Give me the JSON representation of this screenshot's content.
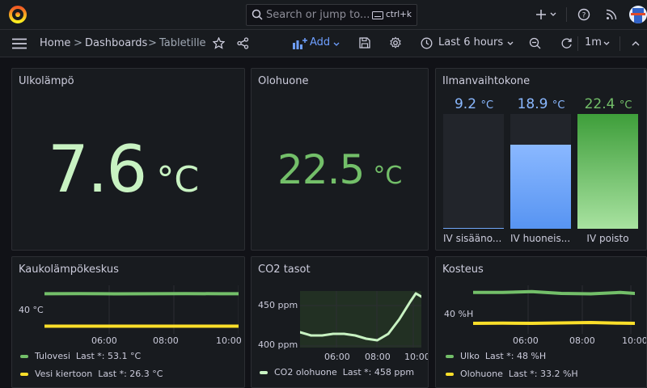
{
  "topbar": {
    "search_placeholder": "Search or jump to...",
    "shortcut": "ctrl+k"
  },
  "nav": {
    "crumb_home": "Home",
    "crumb_dashboards": "Dashboards",
    "crumb_current": "Tabletille",
    "separator": ">",
    "add_label": "Add",
    "time_range": "Last 6 hours",
    "refresh_interval": "1m"
  },
  "colors": {
    "accent_blue": "#6e9fff",
    "green": "#73bf69",
    "light_green": "#c8f2c2",
    "yellow": "#fade2a",
    "light_blue": "#8ab8ff"
  },
  "panels": {
    "ulko": {
      "title": "Ulkolämpö",
      "value": "7.6",
      "unit": "°C"
    },
    "olohuone": {
      "title": "Olohuone",
      "value": "22.5",
      "unit": "°C"
    },
    "iv": {
      "title": "Ilmanvaihtokone",
      "gauges": [
        {
          "value": "9.2",
          "unit": "°C",
          "label": "IV sisäänotto",
          "label_shown": "IV sisääno...",
          "fill": 0.01
        },
        {
          "value": "18.9",
          "unit": "°C",
          "label": "IV huoneisto",
          "label_shown": "IV huoneis...",
          "fill": 0.73
        },
        {
          "value": "22.4",
          "unit": "°C",
          "label": "IV poisto",
          "label_shown": "IV poisto",
          "fill": 1.0
        }
      ]
    },
    "kauko": {
      "title": "Kaukolämpökeskus",
      "y_tick": "40 °C",
      "x_ticks": [
        "06:00",
        "08:00",
        "10:00"
      ],
      "legend": [
        {
          "name": "Tulovesi",
          "last": "Last *: 53.1 °C"
        },
        {
          "name": "Vesi kiertoon",
          "last": "Last *: 26.3 °C"
        }
      ]
    },
    "co2": {
      "title": "CO2 tasot",
      "y_ticks": [
        "450 ppm",
        "400 ppm"
      ],
      "x_ticks": [
        "06:00",
        "08:00",
        "10:00"
      ],
      "legend": [
        {
          "name": "CO2 olohuone",
          "last": "Last *: 458 ppm"
        }
      ]
    },
    "kosteus": {
      "title": "Kosteus",
      "y_tick": "40 %H",
      "x_ticks": [
        "06:00",
        "08:00",
        "10:00"
      ],
      "legend": [
        {
          "name": "Ulko",
          "last": "Last *: 48 %H"
        },
        {
          "name": "Olohuone",
          "last": "Last *: 33.2 %H"
        }
      ]
    }
  },
  "chart_data": [
    {
      "type": "line",
      "title": "Kaukolämpökeskus",
      "ylabel": "",
      "xlabel": "",
      "x": [
        "05:00",
        "06:00",
        "07:00",
        "08:00",
        "09:00",
        "10:00",
        "10:30"
      ],
      "series": [
        {
          "name": "Tulovesi",
          "values": [
            53.1,
            53.2,
            53.0,
            53.1,
            53.2,
            53.1,
            53.1
          ]
        },
        {
          "name": "Vesi kiertoon",
          "values": [
            26.3,
            26.3,
            26.3,
            26.3,
            26.3,
            26.3,
            26.3
          ]
        }
      ]
    },
    {
      "type": "line",
      "title": "CO2 tasot",
      "ylabel": "",
      "xlabel": "",
      "x": [
        "05:00",
        "05:30",
        "06:00",
        "06:30",
        "07:00",
        "07:30",
        "08:00",
        "08:30",
        "09:00",
        "09:30",
        "10:00",
        "10:15",
        "10:30"
      ],
      "series": [
        {
          "name": "CO2 olohuone",
          "values": [
            414,
            410,
            410,
            412,
            412,
            410,
            406,
            404,
            412,
            430,
            452,
            462,
            458
          ]
        }
      ],
      "ylim": [
        395,
        465
      ]
    },
    {
      "type": "line",
      "title": "Kosteus",
      "ylabel": "",
      "xlabel": "",
      "x": [
        "05:00",
        "06:00",
        "07:00",
        "08:00",
        "09:00",
        "10:00",
        "10:30"
      ],
      "series": [
        {
          "name": "Ulko",
          "values": [
            48.5,
            48.5,
            48.9,
            48.0,
            47.8,
            48.5,
            48.0
          ]
        },
        {
          "name": "Olohuone",
          "values": [
            33.2,
            33.3,
            33.2,
            33.4,
            33.6,
            33.3,
            33.2
          ]
        }
      ]
    }
  ]
}
